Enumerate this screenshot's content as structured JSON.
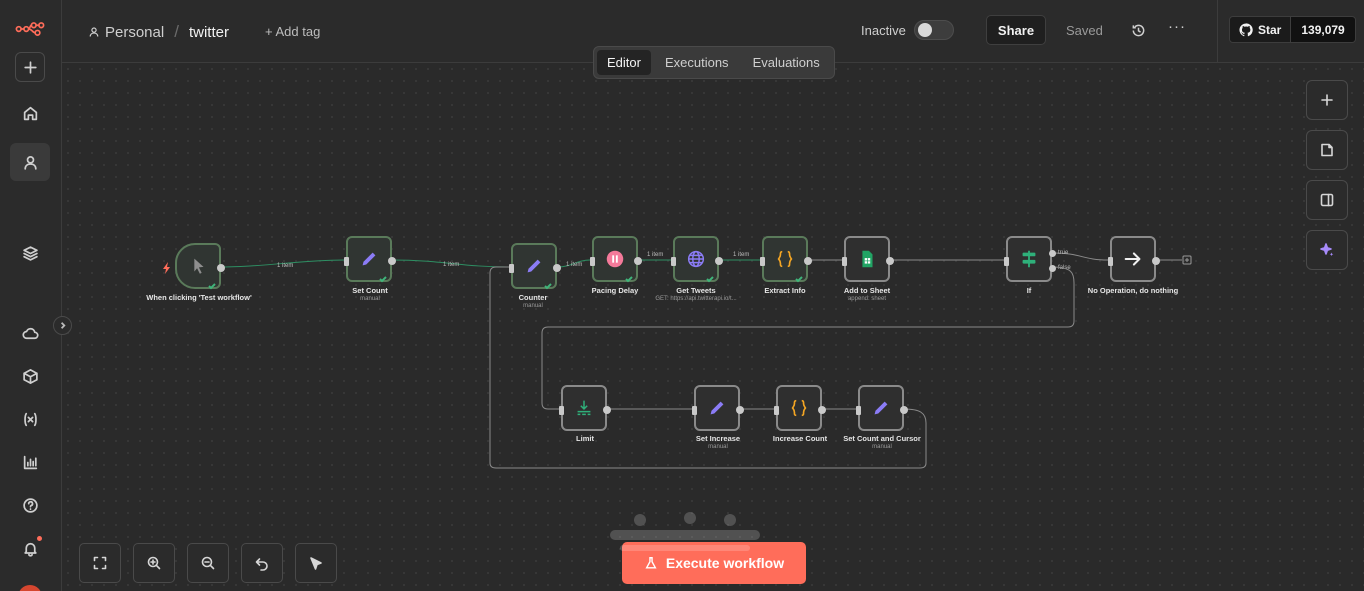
{
  "brand": {
    "logo_icon": "n8n-logo-icon",
    "accent": "#ff6d5a"
  },
  "sidebar": {
    "top_items": [
      {
        "name": "add",
        "icon": "plus-icon"
      },
      {
        "name": "home",
        "icon": "home-icon"
      },
      {
        "name": "personal",
        "icon": "user-icon",
        "active": true
      },
      {
        "name": "projects",
        "icon": "layers-icon"
      }
    ],
    "bottom_items": [
      {
        "name": "cloud",
        "icon": "cloud-icon"
      },
      {
        "name": "templates",
        "icon": "box-icon"
      },
      {
        "name": "variables",
        "icon": "variables-icon"
      },
      {
        "name": "insights",
        "icon": "chart-icon"
      },
      {
        "name": "help",
        "icon": "help-icon"
      },
      {
        "name": "notifications",
        "icon": "bell-icon"
      }
    ]
  },
  "header": {
    "project": "Personal",
    "separator": "/",
    "workflow_name": "twitter",
    "add_tag": "+ Add tag",
    "status_label": "Inactive",
    "active": false,
    "share": "Share",
    "saved": "Saved",
    "more": "···",
    "github": {
      "star_label": "Star",
      "count": "139,079"
    }
  },
  "tabs": [
    {
      "label": "Editor",
      "active": true
    },
    {
      "label": "Executions",
      "active": false
    },
    {
      "label": "Evaluations",
      "active": false
    }
  ],
  "nodes": [
    {
      "id": "trigger",
      "label": "When clicking 'Test workflow'",
      "sub": "",
      "icon": "cursor-icon",
      "executed": true
    },
    {
      "id": "set_count",
      "label": "Set Count",
      "sub": "manual",
      "icon": "pencil-icon",
      "executed": true
    },
    {
      "id": "counter",
      "label": "Counter",
      "sub": "manual",
      "icon": "pencil-icon",
      "executed": true
    },
    {
      "id": "pacing_delay",
      "label": "Pacing Delay",
      "sub": "",
      "icon": "pause-icon",
      "executed": true
    },
    {
      "id": "get_tweets",
      "label": "Get Tweets",
      "sub": "GET: https://api.twitterapi.io/t...",
      "icon": "globe-icon",
      "executed": true
    },
    {
      "id": "extract_info",
      "label": "Extract Info",
      "sub": "",
      "icon": "code-icon",
      "executed": true
    },
    {
      "id": "add_to_sheet",
      "label": "Add to Sheet",
      "sub": "append: sheet",
      "icon": "sheets-icon",
      "executed": false
    },
    {
      "id": "if",
      "label": "If",
      "sub": "",
      "icon": "if-icon",
      "executed": false
    },
    {
      "id": "noop",
      "label": "No Operation, do nothing",
      "sub": "",
      "icon": "arrow-right-icon",
      "executed": false
    },
    {
      "id": "limit",
      "label": "Limit",
      "sub": "",
      "icon": "limit-icon",
      "executed": false
    },
    {
      "id": "set_increase",
      "label": "Set Increase",
      "sub": "manual",
      "icon": "pencil-icon",
      "executed": false
    },
    {
      "id": "increase_count",
      "label": "Increase Count",
      "sub": "",
      "icon": "code-icon",
      "executed": false
    },
    {
      "id": "set_count_cursor",
      "label": "Set Count and Cursor",
      "sub": "manual",
      "icon": "pencil-icon",
      "executed": false
    }
  ],
  "edge_labels": {
    "trigger_set_count": "1 item",
    "set_count_counter": "1 item",
    "counter_pacing": "1 item",
    "pacing_get": "1 item",
    "get_extract": "1 item",
    "if_true": "true",
    "if_false": "false"
  },
  "canvas_controls": [
    {
      "name": "add-node",
      "icon": "plus-icon"
    },
    {
      "name": "sticky-note",
      "icon": "note-icon"
    },
    {
      "name": "toggle-panel",
      "icon": "panel-icon"
    },
    {
      "name": "ai-assistant",
      "icon": "sparkle-icon"
    }
  ],
  "zoom_controls": [
    {
      "name": "fit-view",
      "icon": "fit-icon"
    },
    {
      "name": "zoom-in",
      "icon": "zoom-in-icon"
    },
    {
      "name": "zoom-out",
      "icon": "zoom-out-icon"
    },
    {
      "name": "undo",
      "icon": "undo-icon"
    },
    {
      "name": "clear-execution",
      "icon": "eraser-icon"
    }
  ],
  "execute_button": "Execute workflow"
}
